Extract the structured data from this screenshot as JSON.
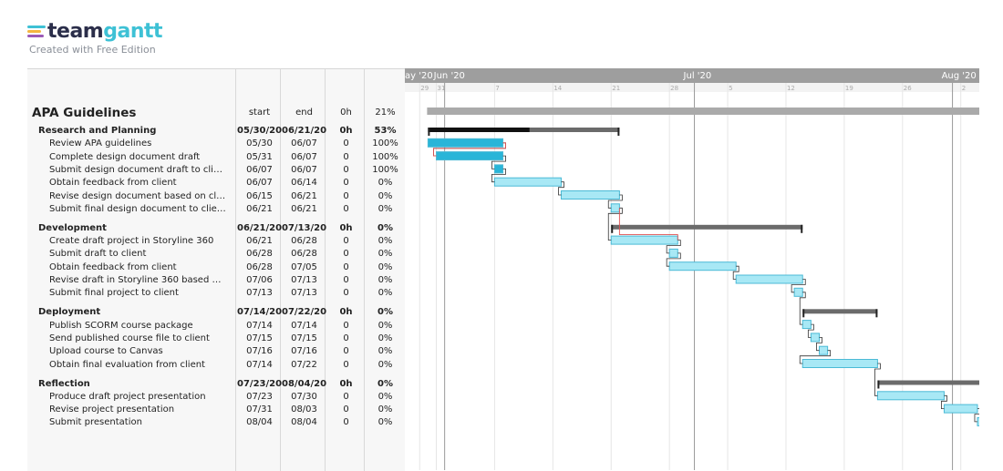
{
  "brand": {
    "logo_part1": "team",
    "logo_part2": "gantt",
    "subtitle": "Created with Free Edition",
    "logo_colors": [
      "#3ec1d5",
      "#f4b63f",
      "#9b59b6"
    ]
  },
  "colors": {
    "task_bar": "#a8e8f5",
    "task_bar_done": "#29b5d8",
    "task_border": "#4bbad6",
    "group_bar": "#6b6b6b",
    "group_progress": "#111111",
    "project_bar": "#aaaaaa",
    "month_header": "#9e9e9e",
    "critical_link": "#e05252"
  },
  "project": {
    "name": "APA Guidelines",
    "col_start": "start",
    "col_end": "end",
    "col_hours": "0h",
    "col_percent": "21%",
    "start": "2020-05-30",
    "end": "2020-08-04"
  },
  "timeline": {
    "months": [
      {
        "label": "ay '20",
        "date": "2020-05-27"
      },
      {
        "label": "Jun '20",
        "date": "2020-06-01"
      },
      {
        "label": "Jul '20",
        "date": "2020-07-01"
      },
      {
        "label": "Aug '20",
        "date": "2020-08-01"
      }
    ],
    "weeks": [
      {
        "label": "29",
        "date": "2020-05-29"
      },
      {
        "label": "31",
        "date": "2020-05-31"
      },
      {
        "label": "7",
        "date": "2020-06-07"
      },
      {
        "label": "14",
        "date": "2020-06-14"
      },
      {
        "label": "21",
        "date": "2020-06-21"
      },
      {
        "label": "28",
        "date": "2020-06-28"
      },
      {
        "label": "5",
        "date": "2020-07-05"
      },
      {
        "label": "12",
        "date": "2020-07-12"
      },
      {
        "label": "19",
        "date": "2020-07-19"
      },
      {
        "label": "26",
        "date": "2020-07-26"
      },
      {
        "label": "2",
        "date": "2020-08-02"
      }
    ],
    "month_lines": [
      "2020-06-01",
      "2020-07-01",
      "2020-08-01"
    ]
  },
  "groups": [
    {
      "name": "Research and Planning",
      "start": "05/30/20",
      "end": "06/21/20",
      "hours": "0h",
      "percent": "53%",
      "bar_start": "2020-05-30",
      "bar_end": "2020-06-21",
      "progress": 0.53,
      "tasks": [
        {
          "name": "Review APA guidelines",
          "start": "05/30",
          "end": "06/07",
          "hours": "0",
          "percent": "100%",
          "bar_start": "2020-05-30",
          "bar_end": "2020-06-07",
          "done": true
        },
        {
          "name": "Complete design document draft",
          "start": "05/31",
          "end": "06/07",
          "hours": "0",
          "percent": "100%",
          "bar_start": "2020-05-31",
          "bar_end": "2020-06-07",
          "done": true
        },
        {
          "name": "Submit design document draft to client",
          "start": "06/07",
          "end": "06/07",
          "hours": "0",
          "percent": "100%",
          "bar_start": "2020-06-07",
          "bar_end": "2020-06-07",
          "done": true
        },
        {
          "name": "Obtain feedback from client",
          "start": "06/07",
          "end": "06/14",
          "hours": "0",
          "percent": "0%",
          "bar_start": "2020-06-07",
          "bar_end": "2020-06-14",
          "done": false
        },
        {
          "name": "Revise design document based on client feedback",
          "start": "06/15",
          "end": "06/21",
          "hours": "0",
          "percent": "0%",
          "bar_start": "2020-06-15",
          "bar_end": "2020-06-21",
          "done": false
        },
        {
          "name": "Submit final design document to client",
          "start": "06/21",
          "end": "06/21",
          "hours": "0",
          "percent": "0%",
          "bar_start": "2020-06-21",
          "bar_end": "2020-06-21",
          "done": false
        }
      ]
    },
    {
      "name": "Development",
      "start": "06/21/20",
      "end": "07/13/20",
      "hours": "0h",
      "percent": "0%",
      "bar_start": "2020-06-21",
      "bar_end": "2020-07-13",
      "progress": 0,
      "tasks": [
        {
          "name": "Create draft project in Storyline 360",
          "start": "06/21",
          "end": "06/28",
          "hours": "0",
          "percent": "0%",
          "bar_start": "2020-06-21",
          "bar_end": "2020-06-28",
          "done": false
        },
        {
          "name": "Submit draft to client",
          "start": "06/28",
          "end": "06/28",
          "hours": "0",
          "percent": "0%",
          "bar_start": "2020-06-28",
          "bar_end": "2020-06-28",
          "done": false
        },
        {
          "name": "Obtain feedback from client",
          "start": "06/28",
          "end": "07/05",
          "hours": "0",
          "percent": "0%",
          "bar_start": "2020-06-28",
          "bar_end": "2020-07-05",
          "done": false
        },
        {
          "name": "Revise draft in Storyline 360 based on client feedback",
          "start": "07/06",
          "end": "07/13",
          "hours": "0",
          "percent": "0%",
          "bar_start": "2020-07-06",
          "bar_end": "2020-07-13",
          "done": false
        },
        {
          "name": "Submit final project to client",
          "start": "07/13",
          "end": "07/13",
          "hours": "0",
          "percent": "0%",
          "bar_start": "2020-07-13",
          "bar_end": "2020-07-13",
          "done": false
        }
      ]
    },
    {
      "name": "Deployment",
      "start": "07/14/20",
      "end": "07/22/20",
      "hours": "0h",
      "percent": "0%",
      "bar_start": "2020-07-14",
      "bar_end": "2020-07-22",
      "progress": 0,
      "tasks": [
        {
          "name": "Publish SCORM course package",
          "start": "07/14",
          "end": "07/14",
          "hours": "0",
          "percent": "0%",
          "bar_start": "2020-07-14",
          "bar_end": "2020-07-14",
          "done": false
        },
        {
          "name": "Send published course file to client",
          "start": "07/15",
          "end": "07/15",
          "hours": "0",
          "percent": "0%",
          "bar_start": "2020-07-15",
          "bar_end": "2020-07-15",
          "done": false
        },
        {
          "name": "Upload course to Canvas",
          "start": "07/16",
          "end": "07/16",
          "hours": "0",
          "percent": "0%",
          "bar_start": "2020-07-16",
          "bar_end": "2020-07-16",
          "done": false
        },
        {
          "name": "Obtain final evaluation from client",
          "start": "07/14",
          "end": "07/22",
          "hours": "0",
          "percent": "0%",
          "bar_start": "2020-07-14",
          "bar_end": "2020-07-22",
          "done": false
        }
      ]
    },
    {
      "name": "Reflection",
      "start": "07/23/20",
      "end": "08/04/20",
      "hours": "0h",
      "percent": "0%",
      "bar_start": "2020-07-23",
      "bar_end": "2020-08-04",
      "progress": 0,
      "tasks": [
        {
          "name": "Produce draft project presentation",
          "start": "07/23",
          "end": "07/30",
          "hours": "0",
          "percent": "0%",
          "bar_start": "2020-07-23",
          "bar_end": "2020-07-30",
          "done": false
        },
        {
          "name": "Revise project presentation",
          "start": "07/31",
          "end": "08/03",
          "hours": "0",
          "percent": "0%",
          "bar_start": "2020-07-31",
          "bar_end": "2020-08-03",
          "done": false
        },
        {
          "name": "Submit presentation",
          "start": "08/04",
          "end": "08/04",
          "hours": "0",
          "percent": "0%",
          "bar_start": "2020-08-04",
          "bar_end": "2020-08-04",
          "done": false
        }
      ]
    }
  ]
}
